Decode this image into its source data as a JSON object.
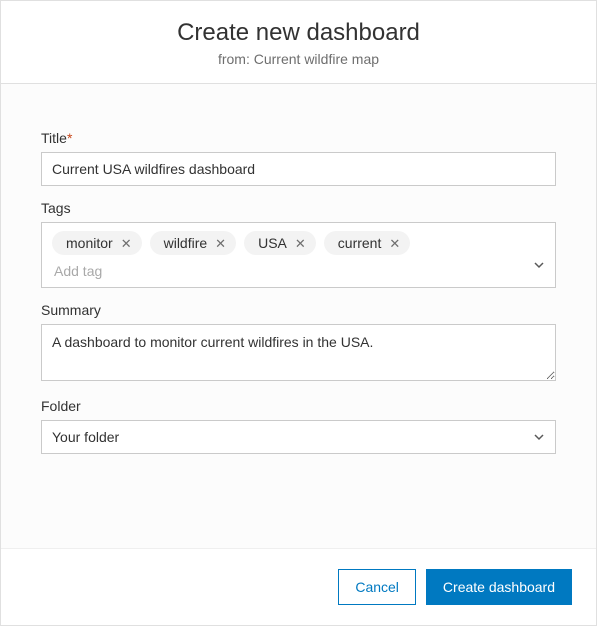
{
  "header": {
    "title": "Create new dashboard",
    "subtitle_prefix": "from: ",
    "source": "Current wildfire map"
  },
  "form": {
    "title": {
      "label": "Title",
      "required_mark": "*",
      "value": "Current USA wildfires dashboard"
    },
    "tags": {
      "label": "Tags",
      "items": [
        "monitor",
        "wildfire",
        "USA",
        "current"
      ],
      "placeholder": "Add tag"
    },
    "summary": {
      "label": "Summary",
      "value": "A dashboard to monitor current wildfires in the USA."
    },
    "folder": {
      "label": "Folder",
      "selected": "Your folder"
    }
  },
  "footer": {
    "cancel": "Cancel",
    "create": "Create dashboard"
  }
}
